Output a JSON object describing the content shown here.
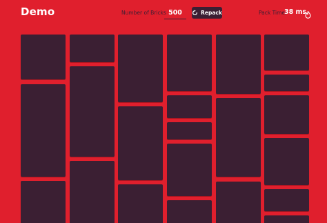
{
  "header": {
    "title": "Demo",
    "bricks_label": "Number of Bricks",
    "bricks_value": "500",
    "repack_label": "Repack",
    "pack_time_label": "Pack Time:",
    "pack_time_value": "38 ms"
  },
  "icons": {
    "repack": "refresh-icon",
    "pack_time": "flame-icon"
  },
  "colors": {
    "background": "#e01f2d",
    "brick": "#3b1f33",
    "text_light": "#ffffff",
    "text_dark": "#3b1f33"
  }
}
